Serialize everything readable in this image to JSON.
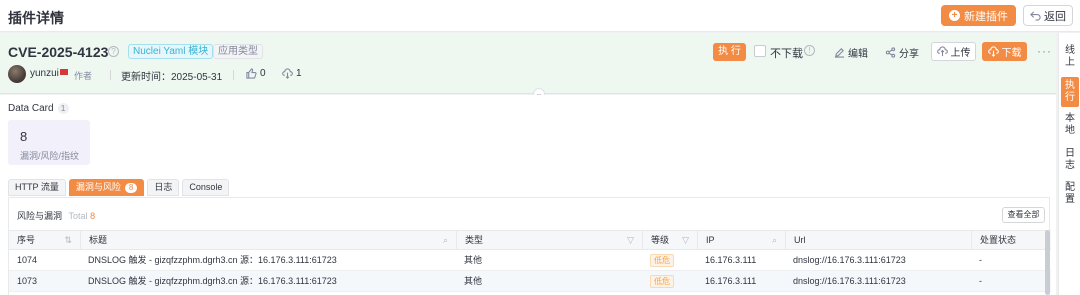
{
  "topbar": {
    "title": "插件详情",
    "new_plugin_label": "新建插件",
    "back_label": "返回"
  },
  "plugin": {
    "name": "CVE-2025-4123",
    "tag_yaml": "Nuclei Yaml 模块",
    "tag_type": "应用类型",
    "author": "yunzui",
    "author_role": "作者",
    "update_time": "更新时间：2025-05-31",
    "likes": "0",
    "downloads": "1"
  },
  "actions": {
    "execute": "执 行",
    "no_download": "不下载",
    "edit": "编辑",
    "share": "分享",
    "upload": "上传",
    "download": "下载"
  },
  "right_rail": [
    "线上",
    "执行",
    "本地",
    "日志",
    "配置"
  ],
  "data_card": {
    "title": "Data Card",
    "count": "1",
    "value": "8",
    "label": "漏洞/风险/指纹"
  },
  "tabs": [
    {
      "label": "HTTP 流量"
    },
    {
      "label": "漏洞与风险",
      "count": "8"
    },
    {
      "label": "日志"
    },
    {
      "label": "Console"
    }
  ],
  "risk_table": {
    "title": "风险与漏洞",
    "total_label": "Total",
    "total": "8",
    "view_all": "查看全部",
    "columns": [
      "序号",
      "标题",
      "类型",
      "等级",
      "IP",
      "Url",
      "处置状态"
    ],
    "rows": [
      {
        "id": "1074",
        "title": "DNSLOG 触发 - gizqfzzphm.dgrh3.cn 源：16.176.3.111:61723",
        "type": "其他",
        "level": "低危",
        "ip": "16.176.3.111",
        "url": "dnslog://16.176.3.111:61723",
        "status": "-"
      },
      {
        "id": "1073",
        "title": "DNSLOG 触发 - gizqfzzphm.dgrh3.cn 源：16.176.3.111:61723",
        "type": "其他",
        "level": "低危",
        "ip": "16.176.3.111",
        "url": "dnslog://16.176.3.111:61723",
        "status": "-"
      }
    ]
  },
  "colors": {
    "accent": "#f28b44",
    "header_bg": "#eef8f1",
    "yaml_tag": "#35b5d4"
  }
}
